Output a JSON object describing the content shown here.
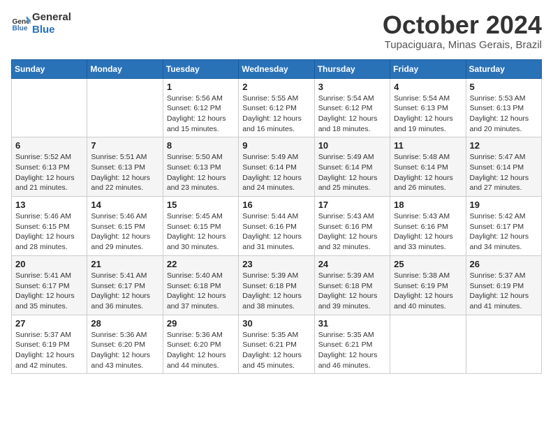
{
  "header": {
    "logo_line1": "General",
    "logo_line2": "Blue",
    "title": "October 2024",
    "subtitle": "Tupaciguara, Minas Gerais, Brazil"
  },
  "calendar": {
    "days_of_week": [
      "Sunday",
      "Monday",
      "Tuesday",
      "Wednesday",
      "Thursday",
      "Friday",
      "Saturday"
    ],
    "weeks": [
      [
        {
          "day": "",
          "info": ""
        },
        {
          "day": "",
          "info": ""
        },
        {
          "day": "1",
          "info": "Sunrise: 5:56 AM\nSunset: 6:12 PM\nDaylight: 12 hours and 15 minutes."
        },
        {
          "day": "2",
          "info": "Sunrise: 5:55 AM\nSunset: 6:12 PM\nDaylight: 12 hours and 16 minutes."
        },
        {
          "day": "3",
          "info": "Sunrise: 5:54 AM\nSunset: 6:12 PM\nDaylight: 12 hours and 18 minutes."
        },
        {
          "day": "4",
          "info": "Sunrise: 5:54 AM\nSunset: 6:13 PM\nDaylight: 12 hours and 19 minutes."
        },
        {
          "day": "5",
          "info": "Sunrise: 5:53 AM\nSunset: 6:13 PM\nDaylight: 12 hours and 20 minutes."
        }
      ],
      [
        {
          "day": "6",
          "info": "Sunrise: 5:52 AM\nSunset: 6:13 PM\nDaylight: 12 hours and 21 minutes."
        },
        {
          "day": "7",
          "info": "Sunrise: 5:51 AM\nSunset: 6:13 PM\nDaylight: 12 hours and 22 minutes."
        },
        {
          "day": "8",
          "info": "Sunrise: 5:50 AM\nSunset: 6:13 PM\nDaylight: 12 hours and 23 minutes."
        },
        {
          "day": "9",
          "info": "Sunrise: 5:49 AM\nSunset: 6:14 PM\nDaylight: 12 hours and 24 minutes."
        },
        {
          "day": "10",
          "info": "Sunrise: 5:49 AM\nSunset: 6:14 PM\nDaylight: 12 hours and 25 minutes."
        },
        {
          "day": "11",
          "info": "Sunrise: 5:48 AM\nSunset: 6:14 PM\nDaylight: 12 hours and 26 minutes."
        },
        {
          "day": "12",
          "info": "Sunrise: 5:47 AM\nSunset: 6:14 PM\nDaylight: 12 hours and 27 minutes."
        }
      ],
      [
        {
          "day": "13",
          "info": "Sunrise: 5:46 AM\nSunset: 6:15 PM\nDaylight: 12 hours and 28 minutes."
        },
        {
          "day": "14",
          "info": "Sunrise: 5:46 AM\nSunset: 6:15 PM\nDaylight: 12 hours and 29 minutes."
        },
        {
          "day": "15",
          "info": "Sunrise: 5:45 AM\nSunset: 6:15 PM\nDaylight: 12 hours and 30 minutes."
        },
        {
          "day": "16",
          "info": "Sunrise: 5:44 AM\nSunset: 6:16 PM\nDaylight: 12 hours and 31 minutes."
        },
        {
          "day": "17",
          "info": "Sunrise: 5:43 AM\nSunset: 6:16 PM\nDaylight: 12 hours and 32 minutes."
        },
        {
          "day": "18",
          "info": "Sunrise: 5:43 AM\nSunset: 6:16 PM\nDaylight: 12 hours and 33 minutes."
        },
        {
          "day": "19",
          "info": "Sunrise: 5:42 AM\nSunset: 6:17 PM\nDaylight: 12 hours and 34 minutes."
        }
      ],
      [
        {
          "day": "20",
          "info": "Sunrise: 5:41 AM\nSunset: 6:17 PM\nDaylight: 12 hours and 35 minutes."
        },
        {
          "day": "21",
          "info": "Sunrise: 5:41 AM\nSunset: 6:17 PM\nDaylight: 12 hours and 36 minutes."
        },
        {
          "day": "22",
          "info": "Sunrise: 5:40 AM\nSunset: 6:18 PM\nDaylight: 12 hours and 37 minutes."
        },
        {
          "day": "23",
          "info": "Sunrise: 5:39 AM\nSunset: 6:18 PM\nDaylight: 12 hours and 38 minutes."
        },
        {
          "day": "24",
          "info": "Sunrise: 5:39 AM\nSunset: 6:18 PM\nDaylight: 12 hours and 39 minutes."
        },
        {
          "day": "25",
          "info": "Sunrise: 5:38 AM\nSunset: 6:19 PM\nDaylight: 12 hours and 40 minutes."
        },
        {
          "day": "26",
          "info": "Sunrise: 5:37 AM\nSunset: 6:19 PM\nDaylight: 12 hours and 41 minutes."
        }
      ],
      [
        {
          "day": "27",
          "info": "Sunrise: 5:37 AM\nSunset: 6:19 PM\nDaylight: 12 hours and 42 minutes."
        },
        {
          "day": "28",
          "info": "Sunrise: 5:36 AM\nSunset: 6:20 PM\nDaylight: 12 hours and 43 minutes."
        },
        {
          "day": "29",
          "info": "Sunrise: 5:36 AM\nSunset: 6:20 PM\nDaylight: 12 hours and 44 minutes."
        },
        {
          "day": "30",
          "info": "Sunrise: 5:35 AM\nSunset: 6:21 PM\nDaylight: 12 hours and 45 minutes."
        },
        {
          "day": "31",
          "info": "Sunrise: 5:35 AM\nSunset: 6:21 PM\nDaylight: 12 hours and 46 minutes."
        },
        {
          "day": "",
          "info": ""
        },
        {
          "day": "",
          "info": ""
        }
      ]
    ]
  }
}
